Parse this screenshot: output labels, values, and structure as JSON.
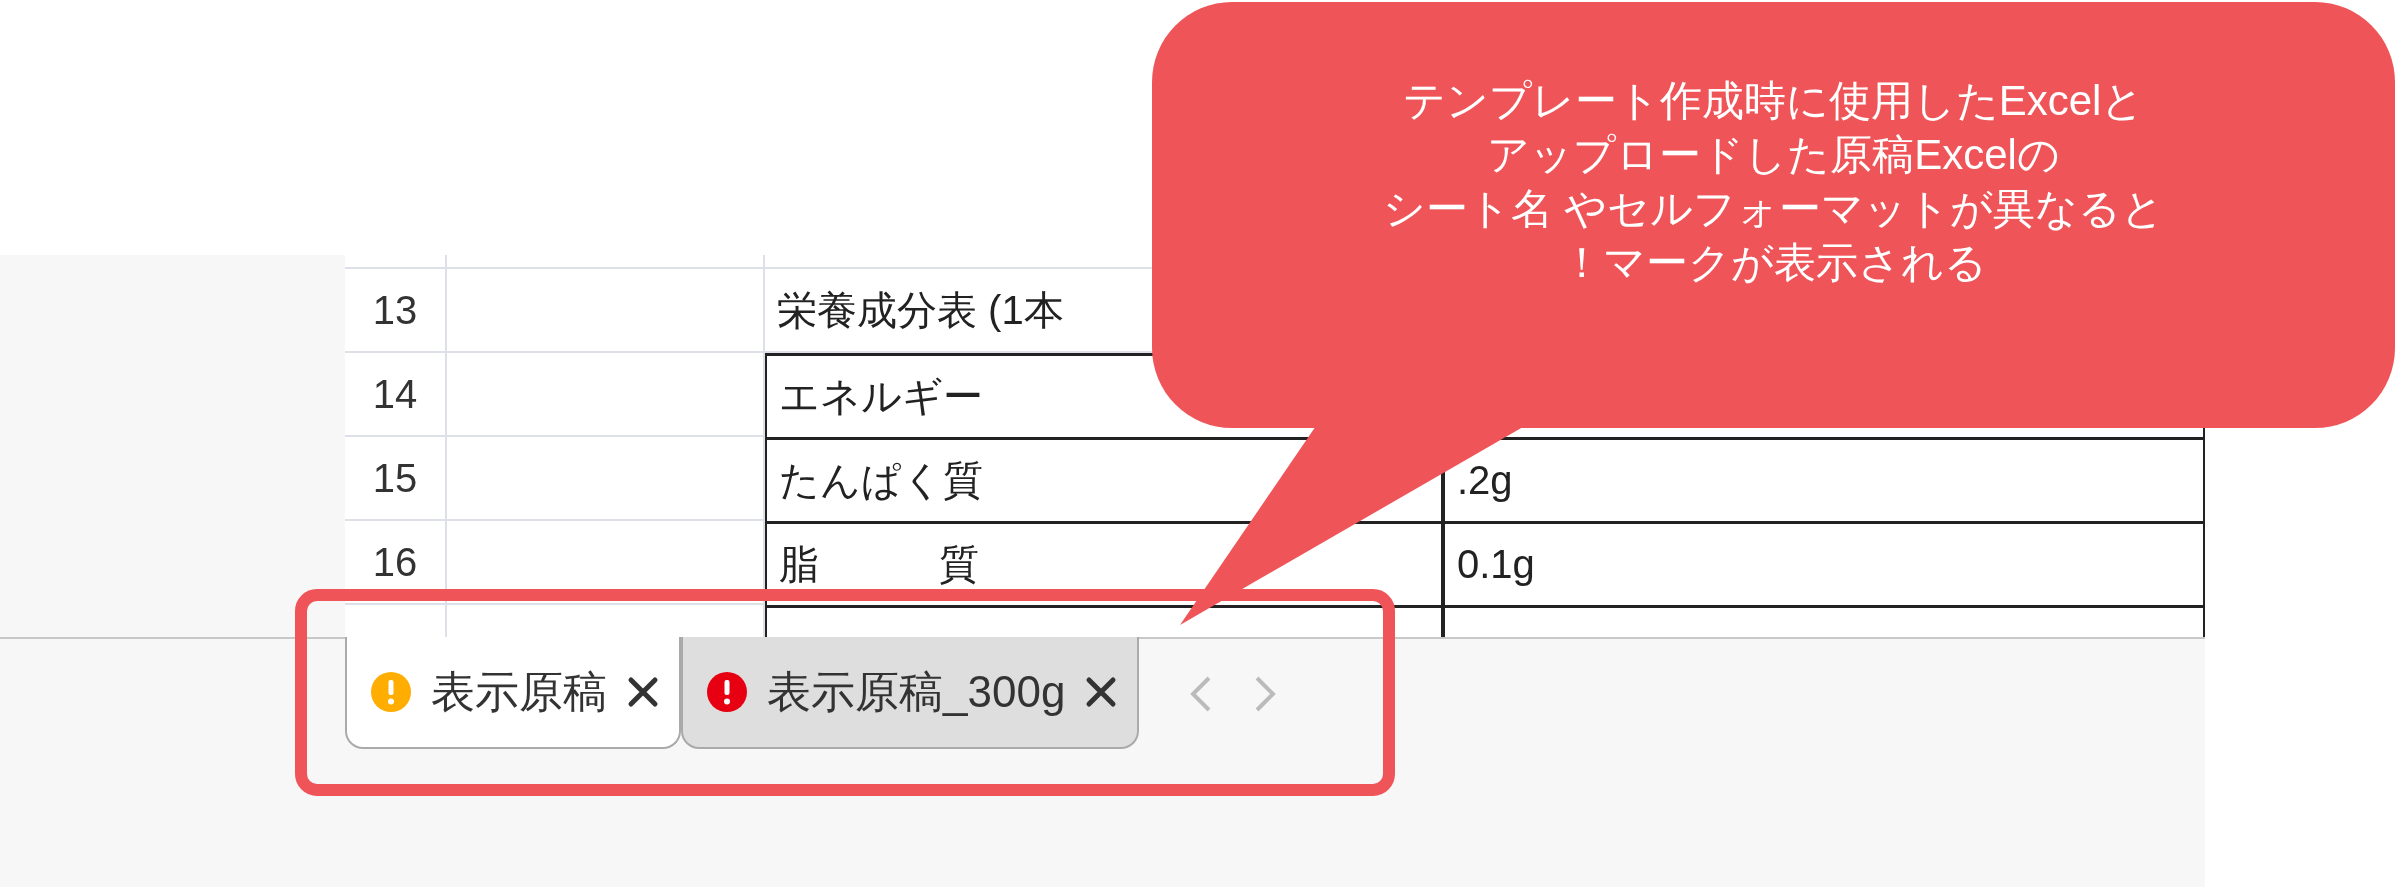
{
  "sheet": {
    "rows": [
      {
        "number": "13",
        "column_c": "栄養成分表 (1本",
        "boxed": false
      },
      {
        "number": "14",
        "column_c": "エネルギー",
        "boxed": true
      },
      {
        "number": "15",
        "column_c": "たんぱく質",
        "column_d": ".2g",
        "boxed": true
      },
      {
        "number": "16",
        "column_c": "脂　　　質",
        "column_d": "0.1g",
        "boxed": true
      },
      {
        "boxed": true
      }
    ]
  },
  "tabs": [
    {
      "label": "表示原稿",
      "kind": "warning",
      "selected": true
    },
    {
      "label": "表示原稿_300g",
      "kind": "error",
      "selected": false
    }
  ],
  "callout": {
    "lines": [
      "テンプレート作成時に使用したExcelと",
      "アップロードした原稿Excelの",
      "シート名 やセルフォーマットが異なると",
      "！マークが表示される"
    ]
  }
}
